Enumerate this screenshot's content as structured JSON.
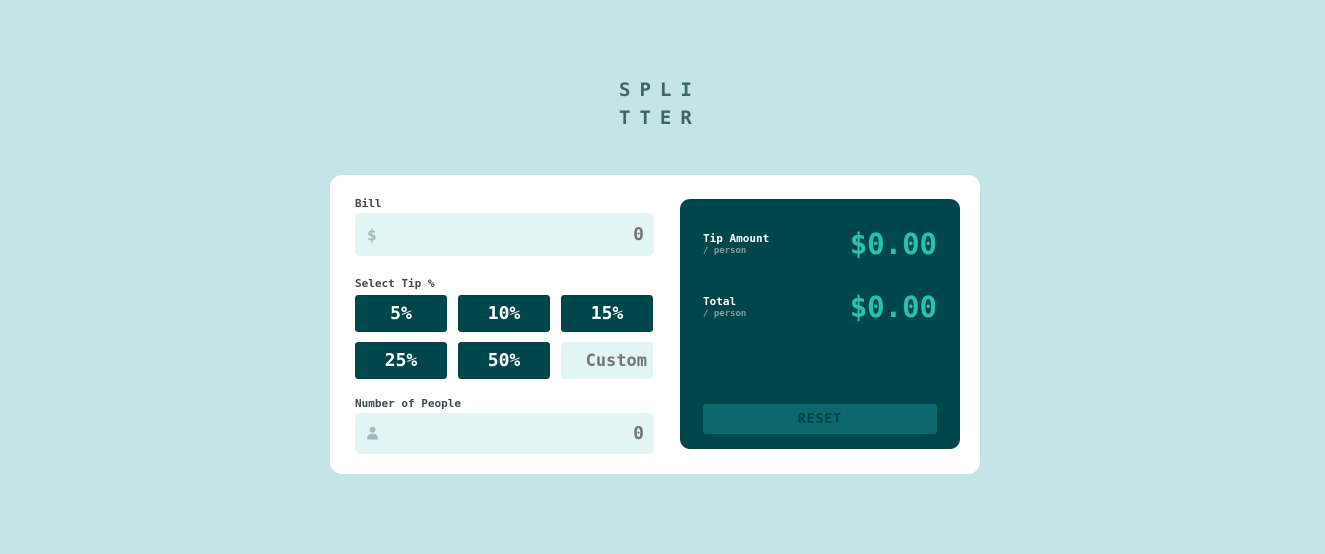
{
  "app": {
    "logo_line1": "SPLI",
    "logo_line2": "TTER"
  },
  "bill": {
    "label": "Bill",
    "currency_symbol": "$",
    "placeholder": "0"
  },
  "tip": {
    "label": "Select Tip %",
    "options": [
      "5%",
      "10%",
      "15%",
      "25%",
      "50%"
    ],
    "custom_placeholder": "Custom"
  },
  "people": {
    "label": "Number of People",
    "placeholder": "0",
    "icon": "person-icon"
  },
  "results": {
    "tip_label": "Tip Amount",
    "tip_sub": "/ person",
    "tip_value": "$0.00",
    "total_label": "Total",
    "total_sub": "/ person",
    "total_value": "$0.00",
    "reset_label": "RESET"
  },
  "colors": {
    "background": "#c5e4e7",
    "dark_cyan": "#00474b",
    "accent": "#26c2ae",
    "input_bg": "#e3f4f4"
  }
}
